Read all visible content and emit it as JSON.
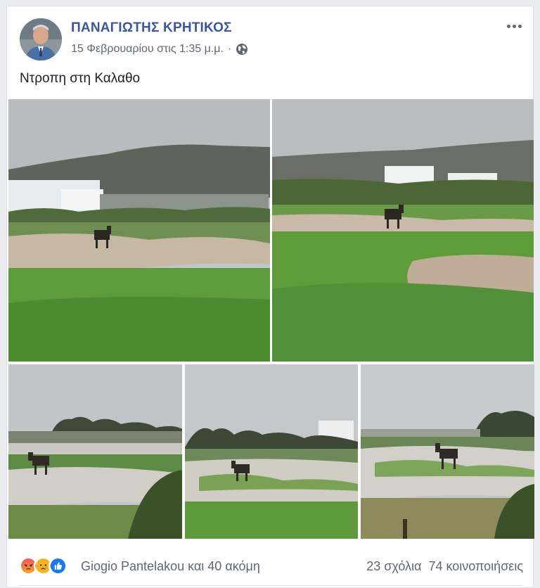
{
  "post": {
    "author": "ΠΑΝΑΓΙΩΤΗΣ ΚΡΗΤΙΚΟΣ",
    "timestamp": "15 Φεβρουαρίου στις 1:35 μ.μ.",
    "separator": "·",
    "privacy_icon": "globe-icon",
    "text": "Ντροπη στη Καλαθο"
  },
  "photos": [
    {
      "name": "photo-1",
      "subject": "donkey"
    },
    {
      "name": "photo-2",
      "subject": "donkey"
    },
    {
      "name": "photo-3",
      "subject": "donkey"
    },
    {
      "name": "photo-4",
      "subject": "donkey"
    },
    {
      "name": "photo-5",
      "subject": "donkey"
    }
  ],
  "reactions": {
    "icons": [
      "angry-react-icon",
      "sad-react-icon",
      "like-react-icon"
    ],
    "names": "Giogio Pantelakou και 40 ακόμη",
    "comments": "23 σχόλια",
    "shares": "74 κοινοποιήσεις"
  },
  "colors": {
    "author_link": "#385898",
    "like_blue": "#1877f2",
    "angry": "#f25268",
    "sad": "#f7b125"
  }
}
